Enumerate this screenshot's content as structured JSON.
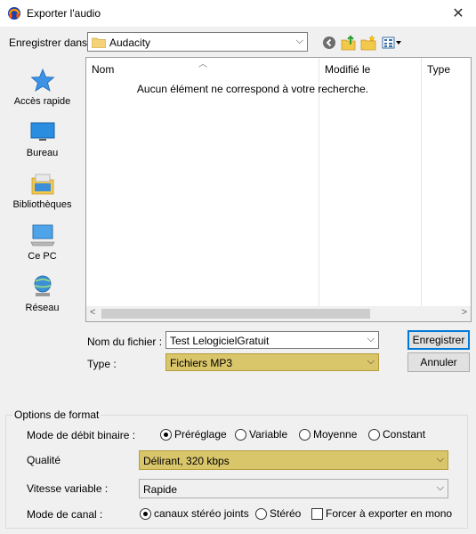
{
  "window": {
    "title": "Exporter l'audio"
  },
  "save_in": {
    "label": "Enregistrer dans :",
    "folder": "Audacity"
  },
  "places": [
    {
      "label": "Accès rapide",
      "icon": "star-icon"
    },
    {
      "label": "Bureau",
      "icon": "desktop-icon"
    },
    {
      "label": "Bibliothèques",
      "icon": "libraries-icon"
    },
    {
      "label": "Ce PC",
      "icon": "computer-icon"
    },
    {
      "label": "Réseau",
      "icon": "network-icon"
    }
  ],
  "filelist": {
    "columns": [
      "Nom",
      "Modifié le",
      "Type"
    ],
    "empty_message": "Aucun élément ne correspond à votre recherche."
  },
  "filename": {
    "label": "Nom du fichier :",
    "value": "Test LelogicielGratuit"
  },
  "type": {
    "label": "Type :",
    "value": "Fichiers MP3"
  },
  "buttons": {
    "save": "Enregistrer",
    "cancel": "Annuler"
  },
  "format_options": {
    "title": "Options de format",
    "bitrate_mode": {
      "label": "Mode de débit binaire :",
      "options": [
        "Préréglage",
        "Variable",
        "Moyenne",
        "Constant"
      ],
      "selected": "Préréglage"
    },
    "quality": {
      "label": "Qualité",
      "value": "Délirant, 320 kbps"
    },
    "variable_speed": {
      "label": "Vitesse variable :",
      "value": "Rapide"
    },
    "channel_mode": {
      "label": "Mode de canal :",
      "options": [
        "canaux stéréo joints",
        "Stéréo"
      ],
      "selected": "canaux stéréo joints",
      "force_mono_label": "Forcer à exporter en mono"
    }
  },
  "colors": {
    "highlight": "#d9c56a",
    "accent": "#0078d7"
  }
}
